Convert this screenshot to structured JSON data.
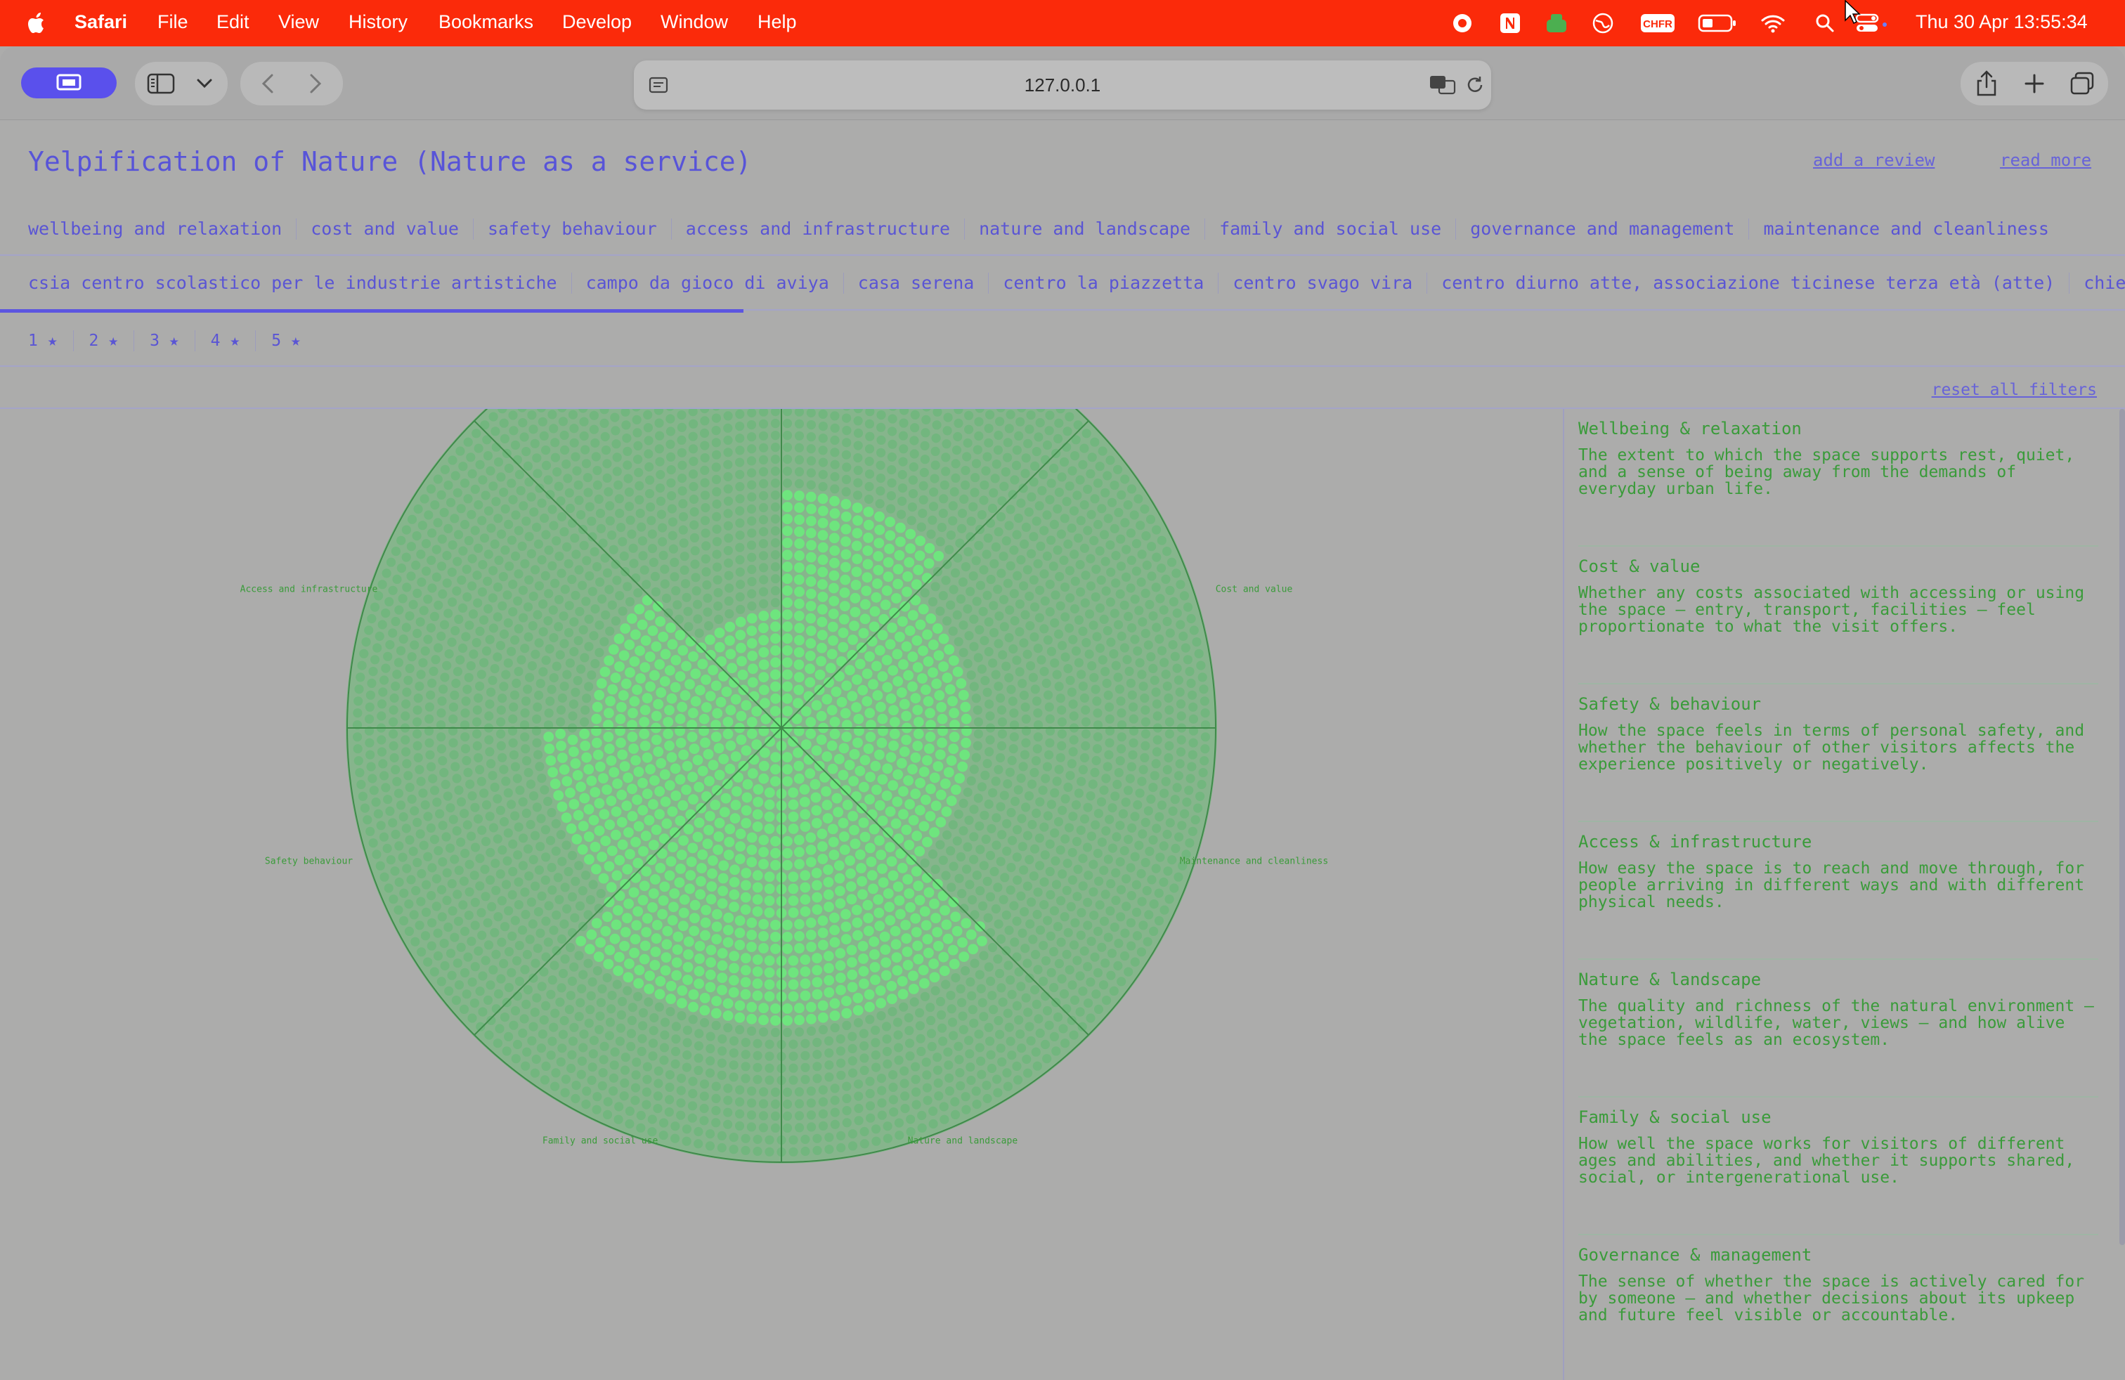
{
  "menubar": {
    "app_name": "Safari",
    "menus": [
      "File",
      "Edit",
      "View",
      "History",
      "Bookmarks",
      "Develop",
      "Window",
      "Help"
    ],
    "status_icons": [
      "record-icon",
      "notion-icon",
      "game-controller-icon",
      "globe-icon",
      "chfr-icon",
      "battery-icon",
      "wifi-icon",
      "search-icon",
      "control-center-icon"
    ],
    "status_chfr_label": "CHFR",
    "clock": "Thu 30 Apr  13:55:34"
  },
  "browser": {
    "url": "127.0.0.1"
  },
  "page": {
    "title": "Yelpification of Nature (Nature as a service)",
    "links": {
      "add_review": "add a review",
      "read_more": "read more"
    },
    "categories": [
      "wellbeing and relaxation",
      "cost and value",
      "safety behaviour",
      "access and infrastructure",
      "nature and landscape",
      "family and social use",
      "governance and management",
      "maintenance and cleanliness"
    ],
    "places": [
      "csia centro scolastico per le industrie artistiche",
      "campo da gioco di aviya",
      "casa serena",
      "centro la piazzetta",
      "centro svago vira",
      "centro diurno atte, associazione ticinese terza età (atte)",
      "chiesa santa"
    ],
    "stars": [
      "1 ★",
      "2 ★",
      "3 ★",
      "4 ★",
      "5 ★"
    ],
    "reset_filters": "reset all filters"
  },
  "chart_data": {
    "type": "radial-dot-sector",
    "title": "",
    "scale_max": 1.0,
    "categories": [
      "Wellbeing and relaxation",
      "Cost and value",
      "Maintenance and cleanliness",
      "Nature and landscape",
      "Family and social use",
      "Safety behaviour",
      "Access and infrastructure",
      "Governance and management"
    ],
    "values": [
      0.54,
      0.44,
      0.44,
      0.69,
      0.69,
      0.54,
      0.44,
      0.29
    ],
    "colors": {
      "background_dots": "#72b67e",
      "highlight_dots": "#6ee57e",
      "grid": "#3f8a4a",
      "labels": "#3a9b3a"
    }
  },
  "descriptions": [
    {
      "title": "Wellbeing & relaxation",
      "text": "The extent to which the space supports rest, quiet, and a sense of being away from the demands of everyday urban life."
    },
    {
      "title": "Cost & value",
      "text": "Whether any costs associated with accessing or using the space — entry, transport, facilities — feel proportionate to what the visit offers."
    },
    {
      "title": "Safety & behaviour",
      "text": "How the space feels in terms of personal safety, and whether the behaviour of other visitors affects the experience positively or negatively."
    },
    {
      "title": "Access & infrastructure",
      "text": "How easy the space is to reach and move through, for people arriving in different ways and with different physical needs."
    },
    {
      "title": "Nature & landscape",
      "text": "The quality and richness of the natural environment — vegetation, wildlife, water, views — and how alive the space feels as an ecosystem."
    },
    {
      "title": "Family & social use",
      "text": "How well the space works for visitors of different ages and abilities, and whether it supports shared, social, or intergenerational use."
    },
    {
      "title": "Governance & management",
      "text": "The sense of whether the space is actively cared for by someone — and whether decisions about its upkeep and future feel visible or accountable."
    }
  ]
}
